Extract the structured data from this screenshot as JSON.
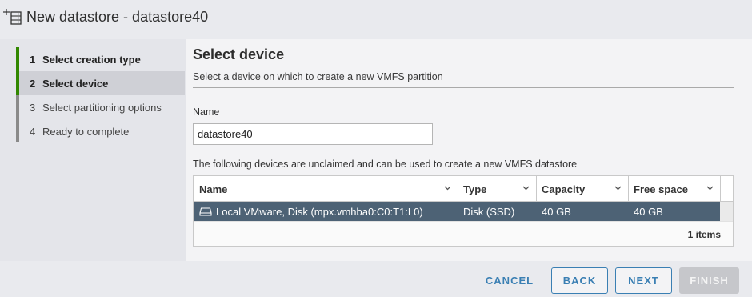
{
  "window": {
    "title": "New datastore - datastore40",
    "icon": "new-datastore-icon"
  },
  "steps": [
    {
      "num": "1",
      "label": "Select creation type",
      "state": "done"
    },
    {
      "num": "2",
      "label": "Select device",
      "state": "active"
    },
    {
      "num": "3",
      "label": "Select partitioning options",
      "state": "todo"
    },
    {
      "num": "4",
      "label": "Ready to complete",
      "state": "todo"
    }
  ],
  "page": {
    "title": "Select device",
    "subtitle": "Select a device on which to create a new VMFS partition",
    "name_label": "Name",
    "name_value": "datastore40",
    "devices_description": "The following devices are unclaimed and can be used to create a new VMFS datastore"
  },
  "grid": {
    "columns": [
      "Name",
      "Type",
      "Capacity",
      "Free space"
    ],
    "rows": [
      {
        "name": "Local VMware, Disk (mpx.vmhba0:C0:T1:L0)",
        "type": "Disk (SSD)",
        "capacity": "40 GB",
        "free_space": "40 GB",
        "icon": "disk-icon",
        "selected": true
      }
    ],
    "footer_count": "1 items"
  },
  "buttons": {
    "cancel": "CANCEL",
    "back": "BACK",
    "next": "NEXT",
    "finish": "FINISH"
  },
  "colors": {
    "accent": "#3a7fb3",
    "step_done": "#318700",
    "selected_row": "#4d6275",
    "disabled_button": "#c6c7cb"
  }
}
